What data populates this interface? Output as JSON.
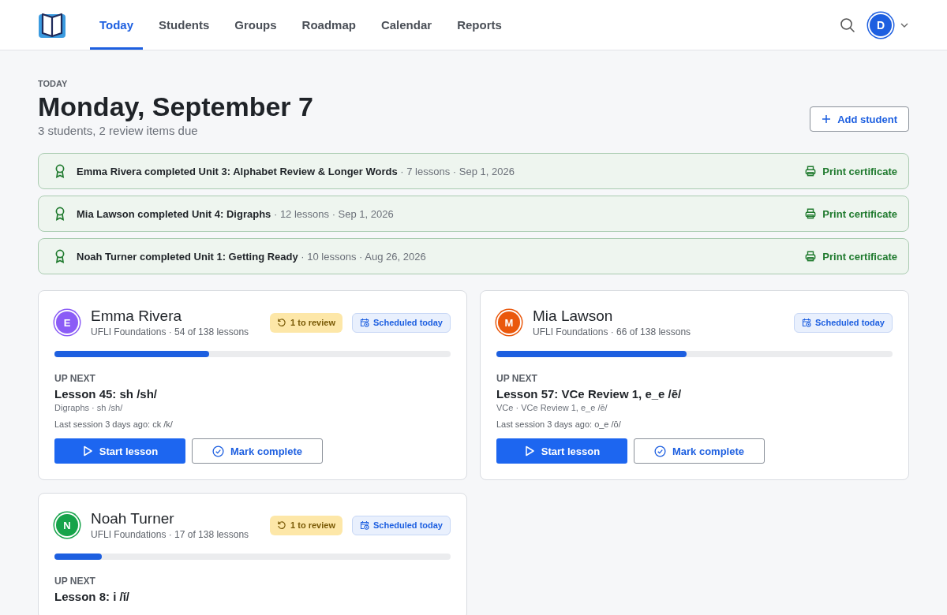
{
  "nav": {
    "tabs": [
      {
        "label": "Today",
        "selected": true
      },
      {
        "label": "Students",
        "selected": false
      },
      {
        "label": "Groups",
        "selected": false
      },
      {
        "label": "Roadmap",
        "selected": false
      },
      {
        "label": "Calendar",
        "selected": false
      },
      {
        "label": "Reports",
        "selected": false
      }
    ],
    "user_initial": "D"
  },
  "header": {
    "eyebrow": "TODAY",
    "title": "Monday, September 7",
    "subtitle": "3 students, 2 review items due",
    "add_button": "Add student"
  },
  "certificates": [
    {
      "title": "Emma Rivera completed Unit 3: Alphabet Review & Longer Words",
      "meta": "· 7 lessons · Sep 1, 2026",
      "action": "Print certificate"
    },
    {
      "title": "Mia Lawson completed Unit 4: Digraphs",
      "meta": "· 12 lessons · Sep 1, 2026",
      "action": "Print certificate"
    },
    {
      "title": "Noah Turner completed Unit 1: Getting Ready",
      "meta": "· 10 lessons · Aug 26, 2026",
      "action": "Print certificate"
    }
  ],
  "students": [
    {
      "initial": "E",
      "color": "#8b5cf6",
      "name": "Emma Rivera",
      "progress": "UFLI Foundations · 54 of 138 lessons",
      "review": "1 to review",
      "scheduled": "Scheduled today",
      "level": 0.39,
      "up_next_label": "UP NEXT",
      "lesson": "Lesson 45: sh /sh/",
      "lesson_detail": "Digraphs · sh /sh/",
      "last_session": "Last session 3 days ago: ck /k/",
      "start": "Start lesson",
      "complete": "Mark complete"
    },
    {
      "initial": "M",
      "color": "#ea580c",
      "name": "Mia Lawson",
      "progress": "UFLI Foundations · 66 of 138 lessons",
      "scheduled": "Scheduled today",
      "level": 0.48,
      "up_next_label": "UP NEXT",
      "lesson": "Lesson 57: VCe Review 1, e_e /ē/",
      "lesson_detail": "VCe · VCe Review 1, e_e /ē/",
      "last_session": "Last session 3 days ago: o_e /ō/",
      "start": "Start lesson",
      "complete": "Mark complete"
    },
    {
      "initial": "N",
      "color": "#16a34a",
      "name": "Noah Turner",
      "progress": "UFLI Foundations · 17 of 138 lessons",
      "review": "1 to review",
      "scheduled": "Scheduled today",
      "level": 0.12,
      "up_next_label": "UP NEXT",
      "lesson": "Lesson 8: i /ĭ/"
    }
  ]
}
